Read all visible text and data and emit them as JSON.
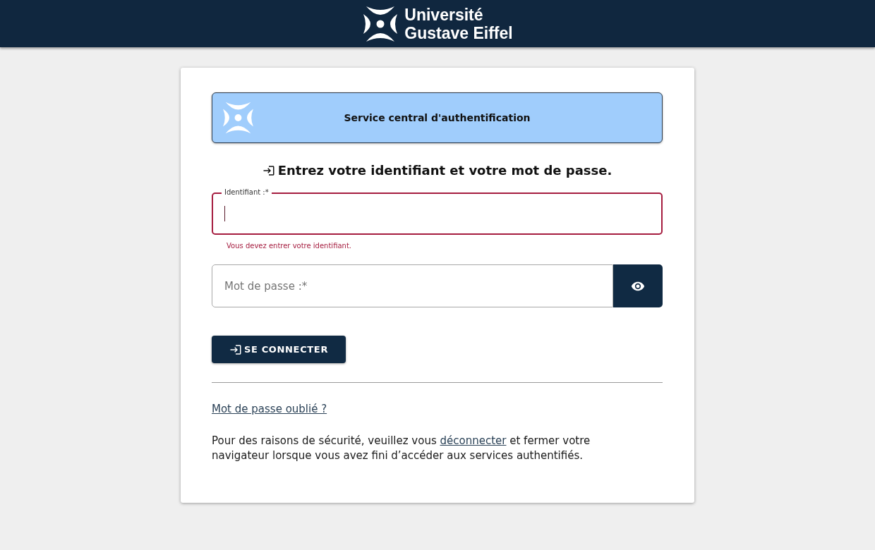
{
  "header": {
    "brand_lines": [
      "Université",
      "Gustave Eiffel"
    ]
  },
  "banner": {
    "title": "Service central d'authentification"
  },
  "heading": "Entrez votre identifiant et votre mot de passe.",
  "fields": [
    {
      "kind": "text",
      "label": "Identifiant :*",
      "invalid": true,
      "focused": true,
      "error": "Vous devez entrer votre identifiant."
    },
    {
      "kind": "password",
      "placeholder": "Mot de passe :*",
      "invalid": false,
      "focused": false
    }
  ],
  "submit_button": "SE CONNECTER",
  "forgot_link": "Mot de passe oublié ?",
  "notice": {
    "before": "Pour des raisons de sécurité, veuillez vous ",
    "link": "déconnecter",
    "after": " et fermer votre navigateur lorsque vous avez fini d’accéder aux services authentifiés."
  }
}
